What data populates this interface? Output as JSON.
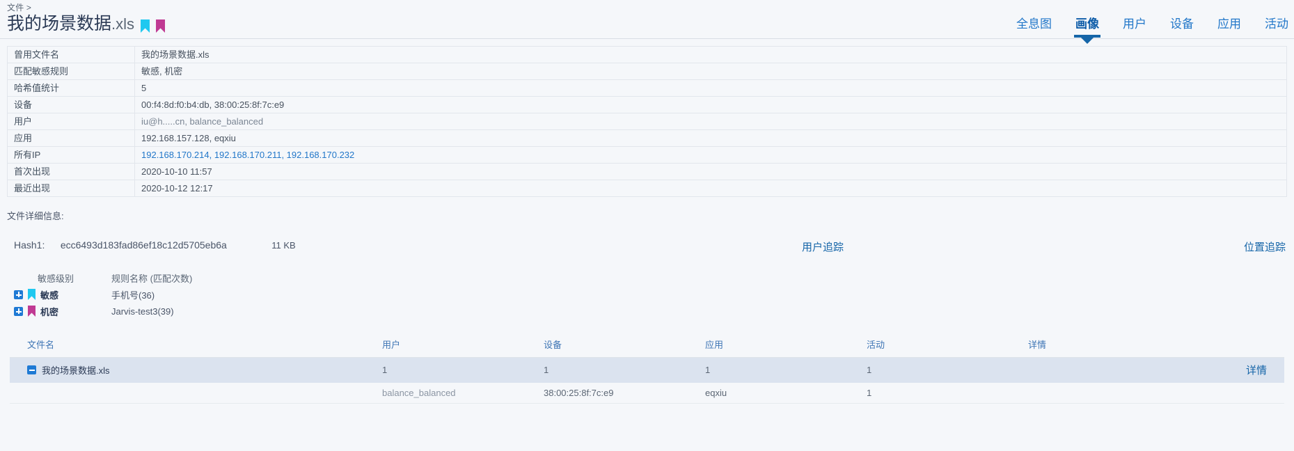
{
  "header": {
    "breadcrumb": "文件 >",
    "file_name": "我的场景数据",
    "file_ext": ".xls",
    "flags": [
      {
        "name": "sensitive-flag",
        "color": "#1fc8f0"
      },
      {
        "name": "confidential-flag",
        "color": "#c03a93"
      }
    ]
  },
  "nav_tabs": [
    {
      "label": "全息图",
      "active": false
    },
    {
      "label": "画像",
      "active": true
    },
    {
      "label": "用户",
      "active": false
    },
    {
      "label": "设备",
      "active": false
    },
    {
      "label": "应用",
      "active": false
    },
    {
      "label": "活动",
      "active": false
    }
  ],
  "info_table": [
    {
      "label": "曾用文件名",
      "value": "我的场景数据.xls",
      "link": false
    },
    {
      "label": "匹配敏感规则",
      "value": "敏感, 机密",
      "link": false
    },
    {
      "label": "哈希值统计",
      "value": "5",
      "link": false
    },
    {
      "label": "设备",
      "value": "00:f4:8d:f0:b4:db, 38:00:25:8f:7c:e9",
      "link": false
    },
    {
      "label": "用户",
      "value": "iu@h.....cn, balance_balanced",
      "link": false,
      "redacted": true
    },
    {
      "label": "应用",
      "value": "192.168.157.128, eqxiu",
      "link": false
    },
    {
      "label": "所有IP",
      "value": "192.168.170.214, 192.168.170.211, 192.168.170.232",
      "link": true
    },
    {
      "label": "首次出现",
      "value": "2020-10-10 11:57",
      "link": false
    },
    {
      "label": "最近出现",
      "value": "2020-10-12 12:17",
      "link": false
    }
  ],
  "file_detail": {
    "section_label": "文件详细信息:",
    "hash_key": "Hash1:",
    "hash_value": "ecc6493d183fad86ef18c12d5705eb6a",
    "file_size": "11 KB",
    "user_trace_label": "用户追踪",
    "location_trace_label": "位置追踪"
  },
  "rules": {
    "headers": {
      "level": "敏感级别",
      "rule": "规则名称 (匹配次数)"
    },
    "rows": [
      {
        "level": "敏感",
        "rule": "手机号(36)",
        "flag_color": "#1fc8f0"
      },
      {
        "level": "机密",
        "rule": "Jarvis-test3(39)",
        "flag_color": "#c03a93"
      }
    ]
  },
  "bottom_table": {
    "headers": [
      "文件名",
      "用户",
      "设备",
      "应用",
      "活动",
      "详情"
    ],
    "rows": [
      {
        "type": "parent",
        "selected": true,
        "name": "我的场景数据.xls",
        "user": "1",
        "device": "1",
        "app": "1",
        "activity": "1",
        "detail": "详情"
      },
      {
        "type": "child",
        "selected": false,
        "name": "",
        "user": "balance_balanced",
        "user_redacted": true,
        "device": "38:00:25:8f:7c:e9",
        "app": "eqxiu",
        "activity": "1",
        "detail": ""
      }
    ]
  },
  "colors": {
    "page_bg": "#f5f7fa",
    "link": "#2277c9",
    "accent": "#1565a8",
    "selected_row": "#dbe3ef",
    "sensitive": "#1fc8f0",
    "confidential": "#c03a93"
  }
}
